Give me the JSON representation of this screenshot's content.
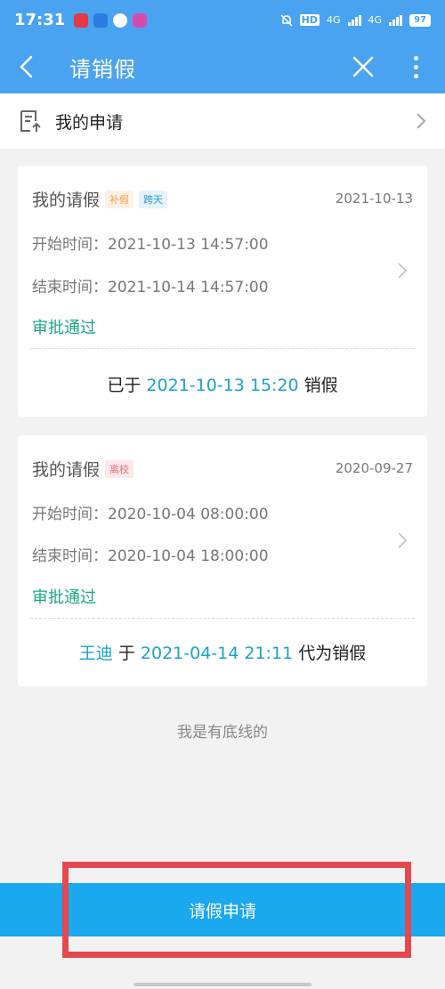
{
  "status_bar": {
    "time": "17:31",
    "battery": "97",
    "network1": "4G",
    "network2": "4G",
    "hd": "HD"
  },
  "header": {
    "title": "请销假"
  },
  "my_application": {
    "label": "我的申请"
  },
  "cards": [
    {
      "title": "我的请假",
      "tags": [
        "补假",
        "跨天"
      ],
      "date": "2021-10-13",
      "start_label": "开始时间：",
      "start_value": "2021-10-13 14:57:00",
      "end_label": "结束时间：",
      "end_value": "2021-10-14 14:57:00",
      "status": "审批通过",
      "footer_prefix": "已于",
      "footer_time": "2021-10-13 15:20",
      "footer_suffix": "销假"
    },
    {
      "title": "我的请假",
      "tags": [
        "离校"
      ],
      "date": "2020-09-27",
      "start_label": "开始时间：",
      "start_value": "2020-10-04 08:00:00",
      "end_label": "结束时间：",
      "end_value": "2020-10-04 18:00:00",
      "status": "审批通过",
      "footer_name": "王迪",
      "footer_prefix": "于",
      "footer_time": "2021-04-14 21:11",
      "footer_suffix": "代为销假"
    }
  ],
  "bottom_text": "我是有底线的",
  "apply_button": {
    "label": "请假申请"
  },
  "colors": {
    "header": "#4aa3f0",
    "button": "#1aa8ef",
    "approved": "#1aa68a",
    "highlight": "#1aa2c8",
    "annotation": "#e4494f"
  }
}
